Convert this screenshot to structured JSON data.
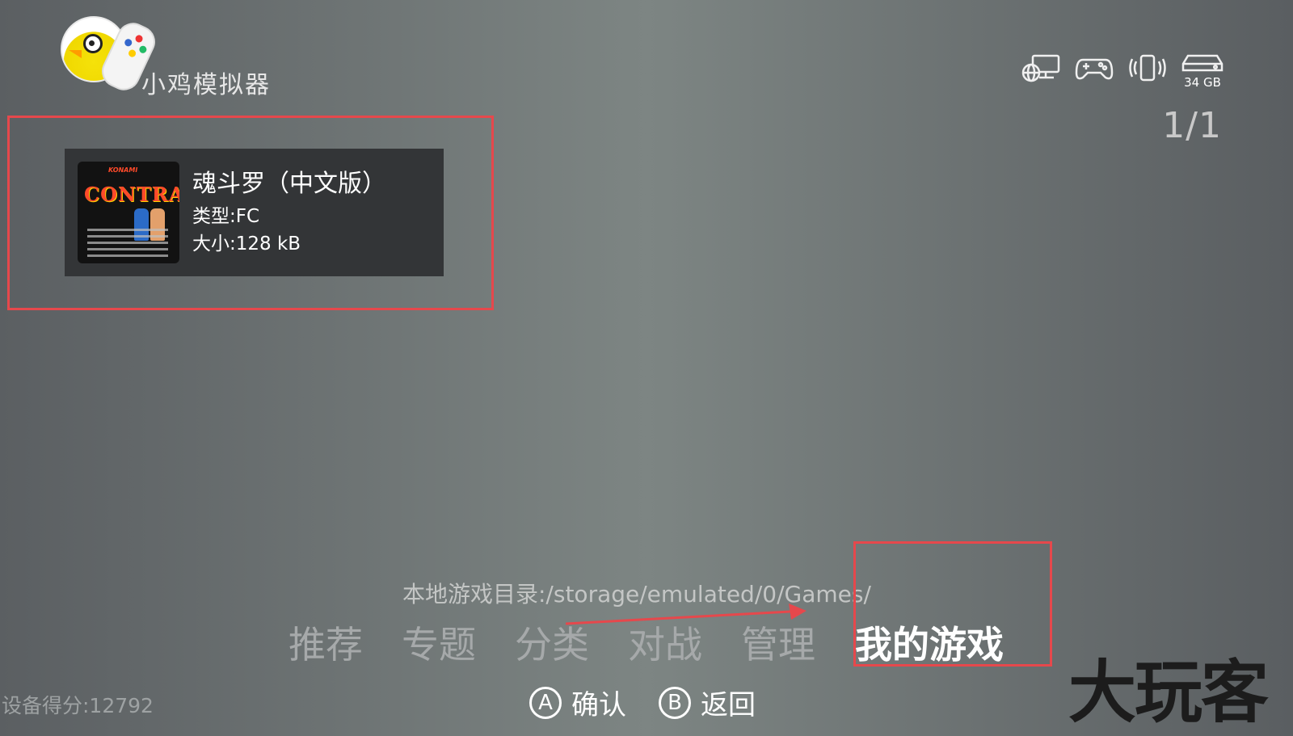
{
  "app": {
    "logo_text": "小鸡模拟器"
  },
  "status": {
    "storage": "34 GB",
    "page_indicator": "1/1",
    "icons": [
      "network-display-icon",
      "gamepad-icon",
      "phone-vibrate-icon",
      "storage-drive-icon"
    ]
  },
  "game": {
    "title": "魂斗罗（中文版）",
    "type": "类型:FC",
    "size": "大小:128 kB",
    "cover_brand": "KONAMI",
    "cover_title": "CONTRA"
  },
  "directory": "本地游戏目录:/storage/emulated/0/Games/",
  "nav": {
    "tabs": [
      "推荐",
      "专题",
      "分类",
      "对战",
      "管理",
      "我的游戏"
    ],
    "active": "我的游戏"
  },
  "controls": {
    "a_key": "A",
    "a_label": "确认",
    "b_key": "B",
    "b_label": "返回"
  },
  "device_score": "设备得分:12792",
  "watermark": "大玩客",
  "colors": {
    "highlight": "#e6484c",
    "card_bg": "#333537"
  }
}
